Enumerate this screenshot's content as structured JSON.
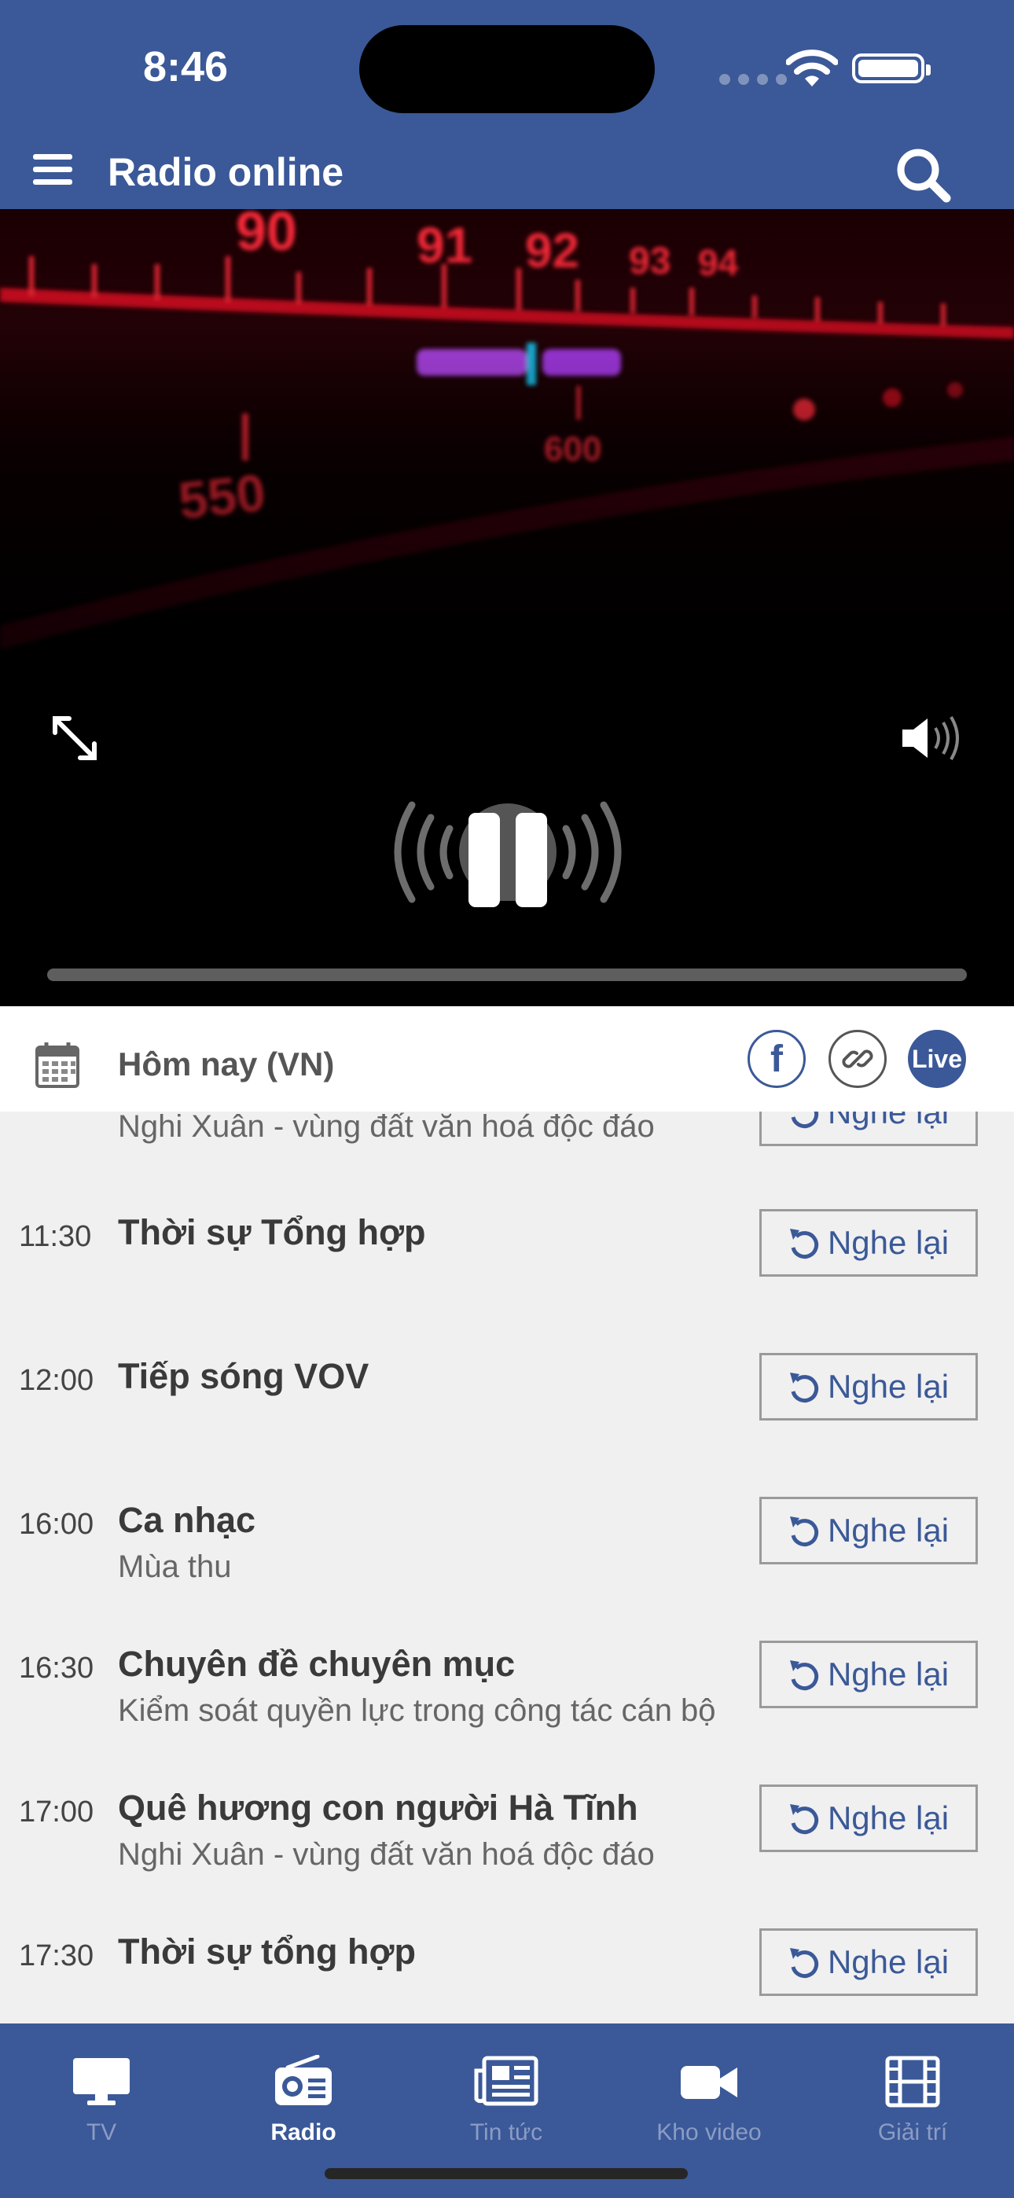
{
  "status_bar": {
    "time": "8:46"
  },
  "header": {
    "title": "Radio online"
  },
  "player": {
    "dial_numbers": [
      "90",
      "91",
      "92",
      "93",
      "94",
      "550",
      "600"
    ],
    "progress": 0.0
  },
  "date_bar": {
    "label": "Hôm nay (VN)",
    "live_label": "Live",
    "facebook_label": "f"
  },
  "schedule": {
    "replay_label": "Nghe lại",
    "partial_row": {
      "desc": "Nghi Xuân - vùng đất văn hoá độc đáo"
    },
    "items": [
      {
        "time": "11:30",
        "title": "Thời sự Tổng hợp",
        "desc": ""
      },
      {
        "time": "12:00",
        "title": "Tiếp sóng VOV",
        "desc": ""
      },
      {
        "time": "16:00",
        "title": "Ca nhạc",
        "desc": "Mùa thu"
      },
      {
        "time": "16:30",
        "title": "Chuyên đề chuyên mục",
        "desc": "Kiểm soát quyền lực trong công tác cán bộ"
      },
      {
        "time": "17:00",
        "title": "Quê hương con người Hà Tĩnh",
        "desc": "Nghi Xuân - vùng đất văn hoá độc đáo"
      },
      {
        "time": "17:30",
        "title": "Thời sự tổng hợp",
        "desc": ""
      }
    ]
  },
  "tabs": [
    {
      "label": "TV",
      "icon": "tv-icon",
      "active": false
    },
    {
      "label": "Radio",
      "icon": "radio-icon",
      "active": true
    },
    {
      "label": "Tin tức",
      "icon": "newspaper-icon",
      "active": false
    },
    {
      "label": "Kho video",
      "icon": "video-camera-icon",
      "active": false
    },
    {
      "label": "Giải trí",
      "icon": "film-icon",
      "active": false
    }
  ],
  "colors": {
    "brand": "#3b5998",
    "dial_red": "#ff1a2e",
    "dial_purple": "#c04bff"
  }
}
